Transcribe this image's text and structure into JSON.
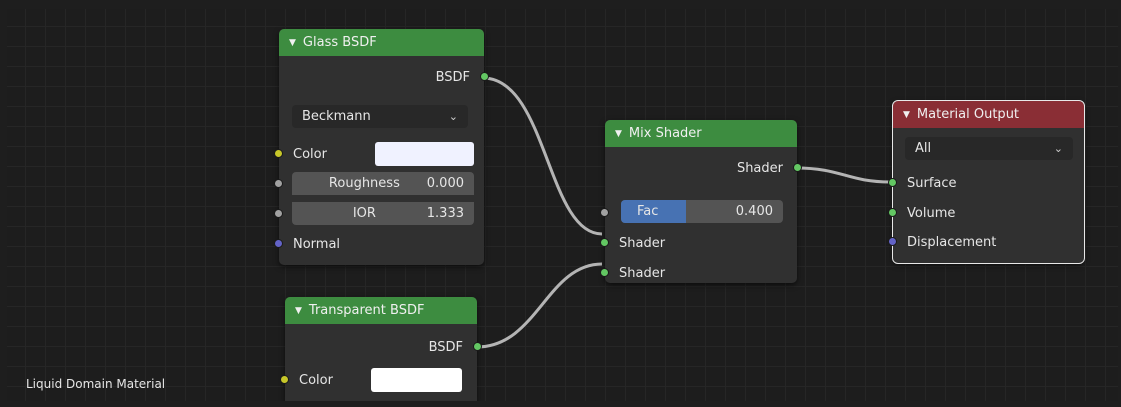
{
  "caption": "Liquid Domain Material",
  "colors": {
    "shader_socket": "#63c763",
    "color_socket": "#c7c729",
    "value_socket": "#a1a1a1",
    "vector_socket": "#6363c7",
    "shader_header": "#3d8c40",
    "output_header": "#8a2e35",
    "slider_fill": "#4772b3"
  },
  "glass": {
    "title": "Glass BSDF",
    "output": "BSDF",
    "distribution": "Beckmann",
    "color_label": "Color",
    "color_value": "#f0f2ff",
    "roughness_label": "Roughness",
    "roughness_value": "0.000",
    "ior_label": "IOR",
    "ior_value": "1.333",
    "normal_label": "Normal"
  },
  "transparent": {
    "title": "Transparent BSDF",
    "output": "BSDF",
    "color_label": "Color",
    "color_value": "#ffffff"
  },
  "mix": {
    "title": "Mix Shader",
    "output": "Shader",
    "fac_label": "Fac",
    "fac_value": "0.400",
    "fac_fraction": 0.4,
    "shader1_label": "Shader",
    "shader2_label": "Shader"
  },
  "output": {
    "title": "Material Output",
    "target": "All",
    "surface_label": "Surface",
    "volume_label": "Volume",
    "displacement_label": "Displacement"
  }
}
